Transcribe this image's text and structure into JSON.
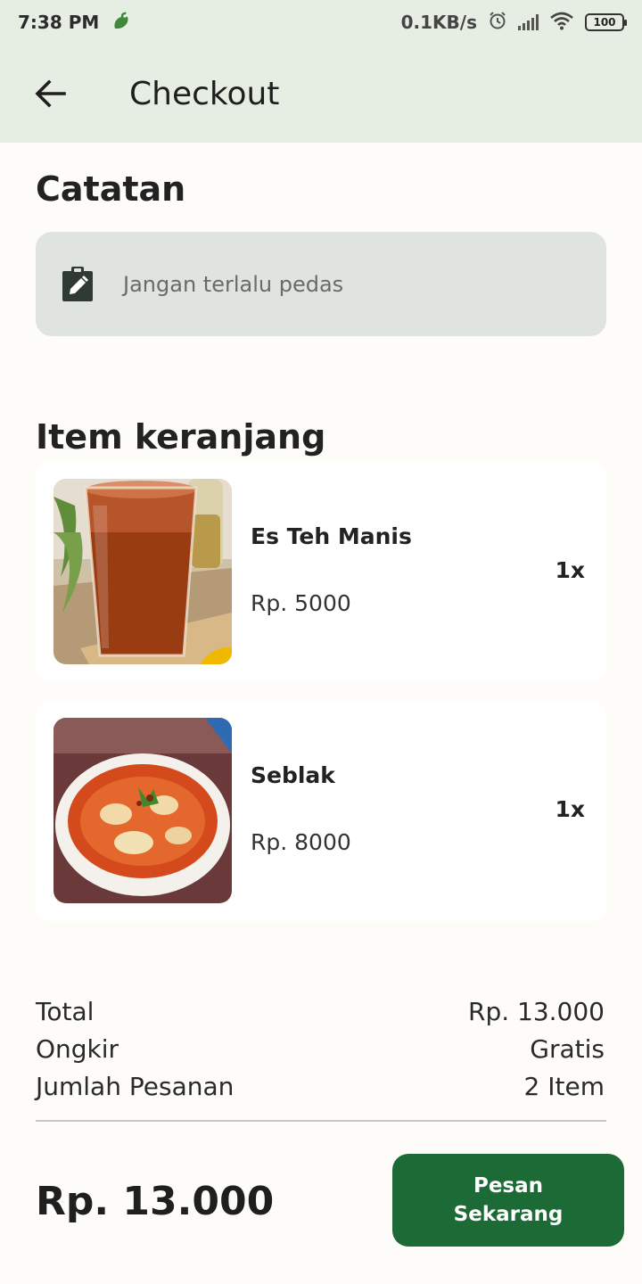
{
  "status_bar": {
    "time": "7:38 PM",
    "network_speed": "0.1KB/s",
    "battery": "100",
    "icons": [
      "app-notification-icon",
      "alarm-icon",
      "signal-icon",
      "wifi-icon",
      "battery-icon"
    ]
  },
  "app_bar": {
    "back_icon": "arrow-left-icon",
    "title": "Checkout"
  },
  "notes": {
    "heading": "Catatan",
    "icon": "clipboard-edit-icon",
    "value": "Jangan terlalu pedas"
  },
  "cart": {
    "heading": "Item keranjang",
    "items": [
      {
        "name": "Es Teh Manis",
        "price": "Rp. 5000",
        "qty": "1x",
        "image": "iced-tea-photo"
      },
      {
        "name": "Seblak",
        "price": "Rp. 8000",
        "qty": "1x",
        "image": "seblak-bowl-photo"
      }
    ]
  },
  "summary": {
    "total_label": "Total",
    "total_value": "Rp. 13.000",
    "shipping_label": "Ongkir",
    "shipping_value": "Gratis",
    "count_label": "Jumlah Pesanan",
    "count_value": "2 Item"
  },
  "footer": {
    "grand_total": "Rp. 13.000",
    "order_button": "Pesan Sekarang"
  },
  "colors": {
    "header_bg": "#e6eee4",
    "page_bg": "#fdfcf8",
    "note_bg": "#dfe5de",
    "accent": "#1c6b36"
  }
}
